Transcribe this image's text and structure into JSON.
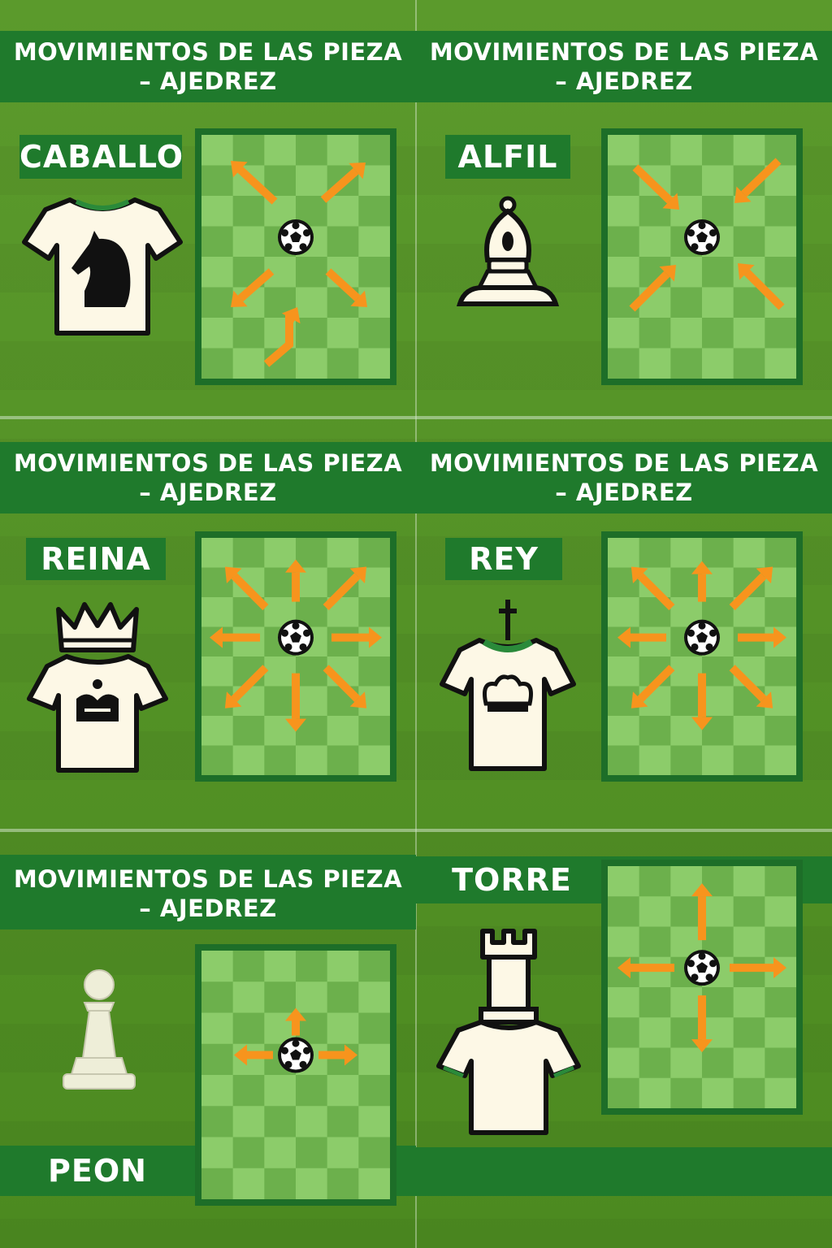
{
  "panels": [
    {
      "key": "caballo",
      "title_line1": "MOVIMIENTOS DE LAS PIEZA",
      "title_line2": "–  AJEDREZ",
      "piece_label": "CABALLO",
      "piece_icon": "knight-shirt-icon",
      "moves": "knight"
    },
    {
      "key": "alfil",
      "title_line1": "MOVIMIENTOS DE LAS PIEZA",
      "title_line2": "–  AJEDREZ",
      "piece_label": "ALFIL",
      "piece_icon": "bishop-icon",
      "moves": "bishop"
    },
    {
      "key": "reina",
      "title_line1": "MOVIMIENTOS DE LAS PIEZA",
      "title_line2": "–  AJEDREZ",
      "piece_label": "REINA",
      "piece_icon": "queen-shirt-icon",
      "moves": "queen"
    },
    {
      "key": "rey",
      "title_line1": "MOVIMIENTOS DE LAS PIEZA",
      "title_line2": "–  AJEDREZ",
      "piece_label": "REY",
      "piece_icon": "king-shirt-icon",
      "moves": "king"
    },
    {
      "key": "peon",
      "title_line1": "MOVIMIENTOS DE LAS PIEZA",
      "title_line2": "–  AJEDREZ",
      "piece_label": "PEON",
      "piece_icon": "pawn-icon",
      "moves": "pawn"
    },
    {
      "key": "torre",
      "piece_label": "TORRE",
      "piece_icon": "rook-shirt-icon",
      "moves": "rook"
    }
  ],
  "colors": {
    "banner": "#1f7a2c",
    "arrow": "#f7941d",
    "board_light": "#8ccc6a",
    "board_dark": "#6cb04c",
    "shirt": "#fdf8e6",
    "field": "#4f8a22"
  }
}
